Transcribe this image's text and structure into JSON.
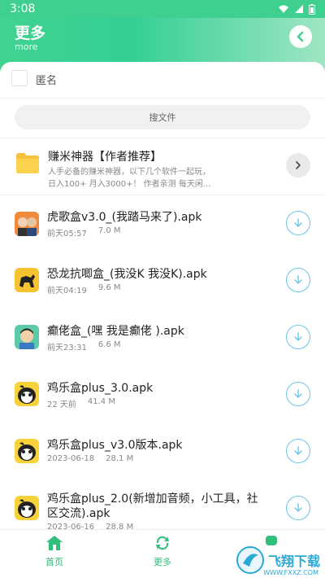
{
  "status_bar": {
    "time": "3:08",
    "icons": [
      "wifi-icon",
      "signal-icon",
      "battery-icon"
    ]
  },
  "header": {
    "title": "更多",
    "subtitle": "more"
  },
  "anonymous": {
    "label": "匿名"
  },
  "search": {
    "placeholder": "搜文件"
  },
  "promo": {
    "title": "赚米神器【作者推荐】",
    "desc_line1": "人手必备的赚米神器，以下几个软件一起玩，",
    "desc_line2": "日入100+ 月入3000+！ 作者亲测 每天闲..."
  },
  "files": [
    {
      "name": "虎歌盒v3.0_(我踏马来了).apk",
      "time": "前天05:57",
      "size": "7.0 M"
    },
    {
      "name": "恐龙抗唧盒_(我没K 我没K).apk",
      "time": "前天04:19",
      "size": "9.6 M"
    },
    {
      "name": "癫佬盒_(嘿 我是癫佬 ).apk",
      "time": "前天23:31",
      "size": "6.6 M"
    },
    {
      "name": "鸡乐盒plus_3.0.apk",
      "time": "22 天前",
      "size": "41.4 M"
    },
    {
      "name": "鸡乐盒plus_v3.0版本.apk",
      "time": "2023-06-18",
      "size": "28.1 M"
    },
    {
      "name": "鸡乐盒plus_2.0(新增加音频，小工具，社区交流).apk",
      "time": "2023-06-16",
      "size": "28.8 M"
    }
  ],
  "nav": {
    "home": "首页",
    "more": "更多"
  },
  "watermark": {
    "text": "飞翔下载",
    "url": "WWW.FXXZ.COM"
  },
  "colors": {
    "accent": "#3fcf8e",
    "download_ring": "#6bc6e8",
    "nav_text": "#2fbf7a"
  }
}
